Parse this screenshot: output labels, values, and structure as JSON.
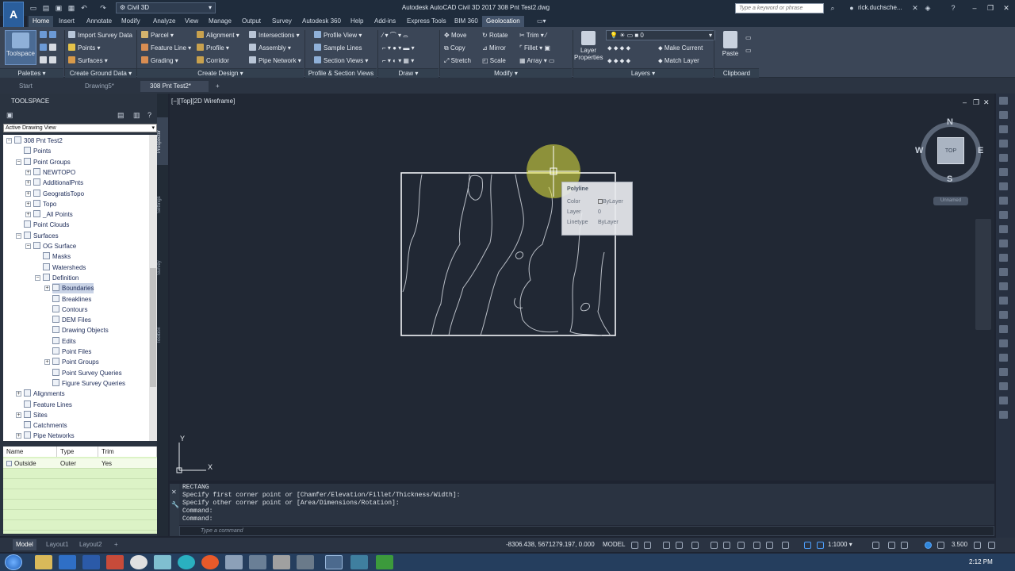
{
  "titlebar": {
    "app_letter": "A",
    "app_sub": "CIV",
    "workspace": "Civil 3D",
    "title": "Autodesk AutoCAD Civil 3D 2017    308 Pnt Test2.dwg",
    "search_placeholder": "Type a keyword or phrase",
    "user": "rick.duchsche..."
  },
  "ribbon_tabs": [
    "Home",
    "Insert",
    "Annotate",
    "Modify",
    "Analyze",
    "View",
    "Manage",
    "Output",
    "Survey",
    "Autodesk 360",
    "Help",
    "Add-ins",
    "Express Tools",
    "BIM 360",
    "Geolocation"
  ],
  "ribbon": {
    "toolspace": "Toolspace",
    "import_survey": "Import Survey Data",
    "points": "Points",
    "surfaces": "Surfaces",
    "parcel": "Parcel",
    "feature_line": "Feature Line",
    "grading": "Grading",
    "alignment": "Alignment",
    "profile": "Profile",
    "corridor": "Corridor",
    "intersections": "Intersections",
    "assembly": "Assembly",
    "pipe_network": "Pipe Network",
    "profile_view": "Profile View",
    "sample_lines": "Sample Lines",
    "section_views": "Section Views",
    "move": "Move",
    "rotate": "Rotate",
    "trim": "Trim",
    "copy": "Copy",
    "mirror": "Mirror",
    "fillet": "Fillet",
    "stretch": "Stretch",
    "scale": "Scale",
    "array": "Array",
    "layer_properties_1": "Layer",
    "layer_properties_2": "Properties",
    "layer_value": "0",
    "make_current": "Make Current",
    "match_layer": "Match Layer",
    "paste": "Paste",
    "panels": [
      "Palettes",
      "Create Ground Data",
      "Create Design",
      "Profile & Section Views",
      "Draw",
      "Modify",
      "Layers",
      "Clipboard"
    ]
  },
  "doc_tabs": [
    "Start",
    "Drawing5*",
    "308 Pnt Test2*"
  ],
  "toolspace": {
    "title": "TOOLSPACE",
    "view": "Active Drawing View",
    "vertical_tabs": [
      "Prospector",
      "Settings",
      "Survey",
      "Toolbox"
    ],
    "tree": [
      {
        "label": "308 Pnt Test2",
        "level": 0
      },
      {
        "label": "Points",
        "level": 1
      },
      {
        "label": "Point Groups",
        "level": 1
      },
      {
        "label": "NEWTOPO",
        "level": 2
      },
      {
        "label": "AdditionalPnts",
        "level": 2
      },
      {
        "label": "GeogratisTopo",
        "level": 2
      },
      {
        "label": "Topo",
        "level": 2
      },
      {
        "label": "_All Points",
        "level": 2
      },
      {
        "label": "Point Clouds",
        "level": 1
      },
      {
        "label": "Surfaces",
        "level": 1
      },
      {
        "label": "OG Surface",
        "level": 2
      },
      {
        "label": "Masks",
        "level": 3
      },
      {
        "label": "Watersheds",
        "level": 3
      },
      {
        "label": "Definition",
        "level": 3
      },
      {
        "label": "Boundaries",
        "level": 4
      },
      {
        "label": "Breaklines",
        "level": 4
      },
      {
        "label": "Contours",
        "level": 4
      },
      {
        "label": "DEM Files",
        "level": 4
      },
      {
        "label": "Drawing Objects",
        "level": 4
      },
      {
        "label": "Edits",
        "level": 4
      },
      {
        "label": "Point Files",
        "level": 4
      },
      {
        "label": "Point Groups",
        "level": 4
      },
      {
        "label": "Point Survey Queries",
        "level": 4
      },
      {
        "label": "Figure Survey Queries",
        "level": 4
      },
      {
        "label": "Alignments",
        "level": 1
      },
      {
        "label": "Feature Lines",
        "level": 1
      },
      {
        "label": "Sites",
        "level": 1
      },
      {
        "label": "Catchments",
        "level": 1
      },
      {
        "label": "Pipe Networks",
        "level": 1
      }
    ],
    "grid_headers": [
      "Name",
      "Type",
      "Trim"
    ],
    "grid_row": [
      "Outside",
      "Outer",
      "Yes"
    ]
  },
  "viewport": {
    "label": "[−][Top][2D Wireframe]",
    "compass": {
      "n": "N",
      "s": "S",
      "e": "E",
      "w": "W",
      "top": "TOP",
      "unnamed": "Unnamed"
    },
    "tooltip": {
      "title": "Polyline",
      "rows": [
        [
          "Color",
          "ByLayer"
        ],
        [
          "Layer",
          "0"
        ],
        [
          "Linetype",
          "ByLayer"
        ]
      ]
    },
    "ucs_y": "Y",
    "ucs_x": "X"
  },
  "command": {
    "history": [
      "RECTANG",
      "Specify first corner point or [Chamfer/Elevation/Fillet/Thickness/Width]:",
      "Specify other corner point or [Area/Dimensions/Rotation]:",
      "Command:",
      "Command:"
    ],
    "placeholder": "Type a command"
  },
  "statusbar": {
    "tabs": [
      "Model",
      "Layout1",
      "Layout2"
    ],
    "coords": "-8306.438, 5671279.197, 0.000",
    "model": "MODEL",
    "scale": "1:1000",
    "value": "3.500"
  },
  "taskbar": {
    "time": "2:12 PM"
  },
  "colors": {
    "accent": "#1f2c3c",
    "canvas": "#212834",
    "ribbon": "#3b4657",
    "highlight": "#e8e840"
  }
}
